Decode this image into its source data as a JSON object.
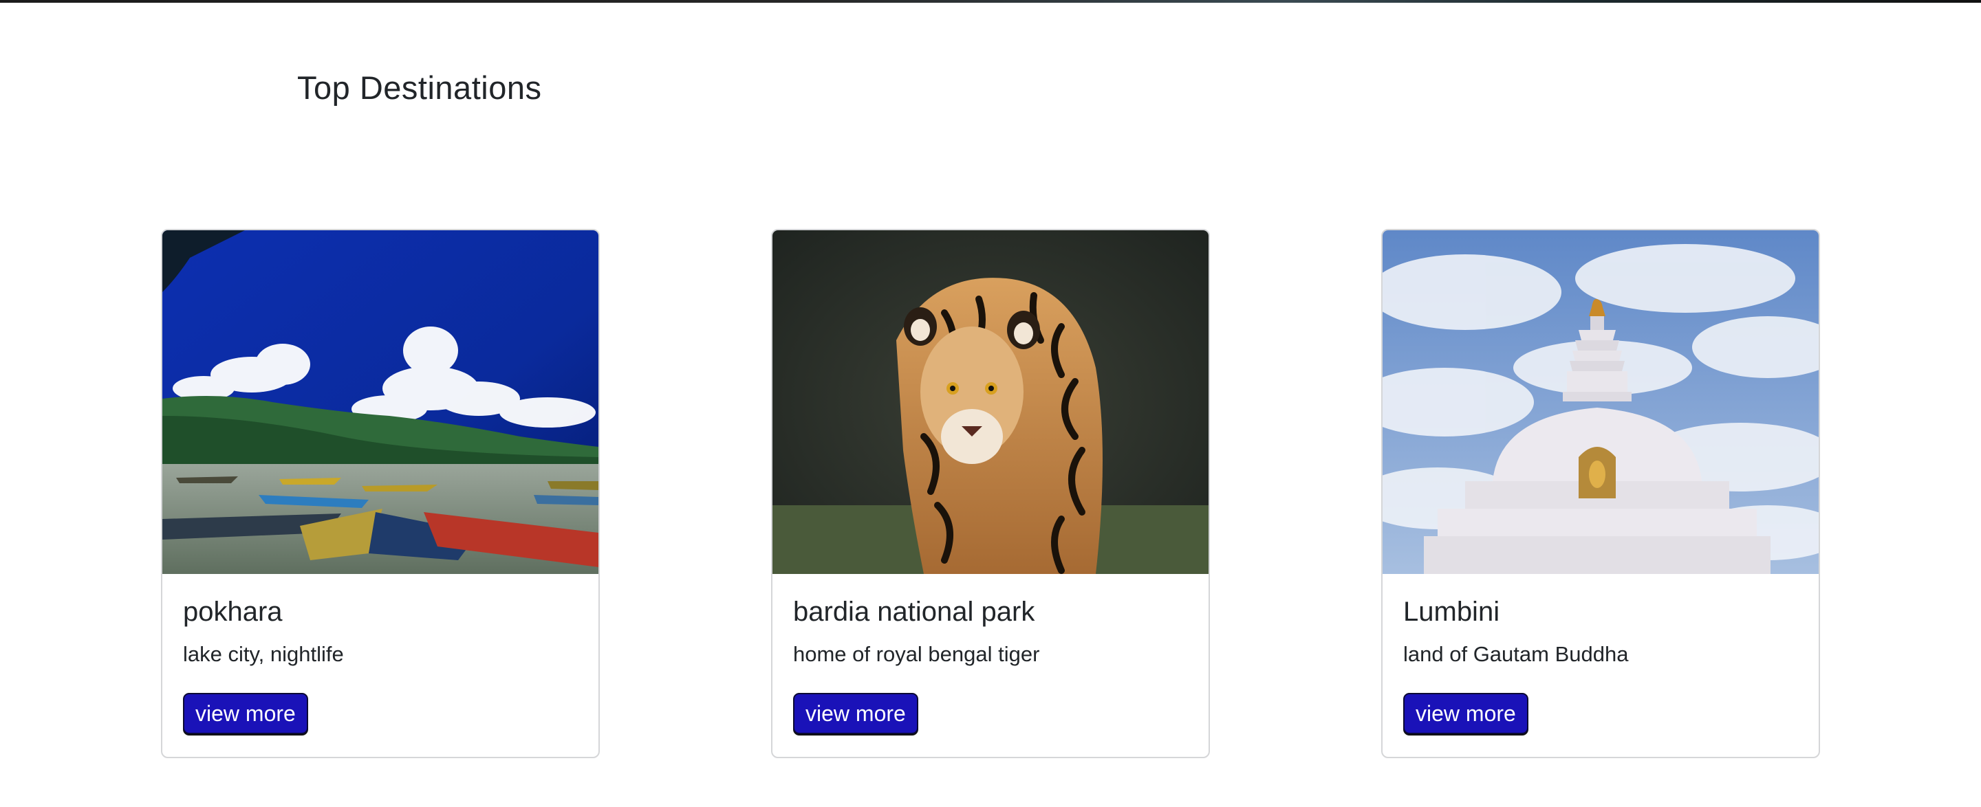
{
  "section": {
    "title": "Top Destinations"
  },
  "cards": [
    {
      "title": "pokhara",
      "text": "lake city, nightlife",
      "button_label": "view more",
      "image": "lake-boats-mountains-photo"
    },
    {
      "title": "bardia national park",
      "text": "home of royal bengal tiger",
      "button_label": "view more",
      "image": "bengal-tiger-photo"
    },
    {
      "title": "Lumbini",
      "text": "land of Gautam Buddha",
      "button_label": "view more",
      "image": "white-stupa-sky-photo"
    }
  ],
  "colors": {
    "button_bg": "#1a12b8",
    "text": "#212529",
    "card_border": "#d5d6d8"
  }
}
